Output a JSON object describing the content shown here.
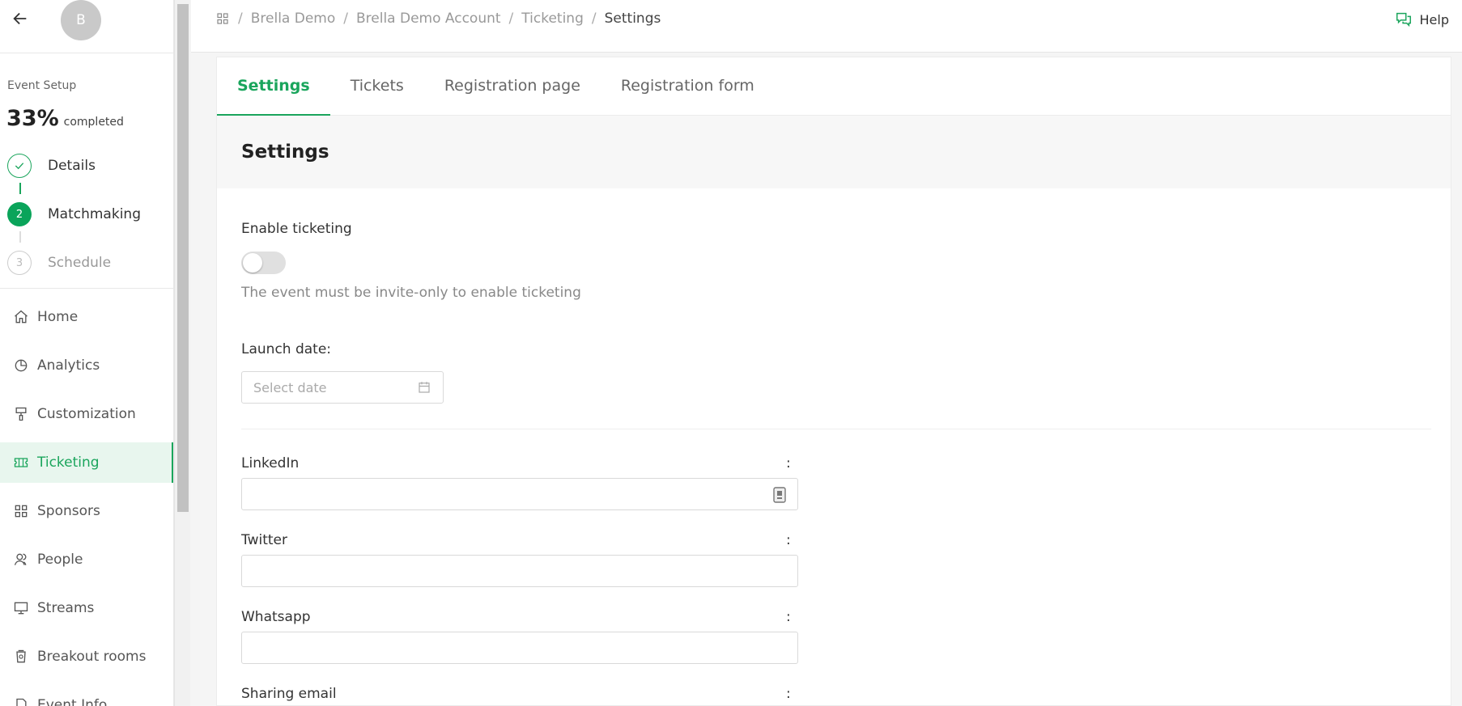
{
  "sidebar": {
    "avatar_initial": "B",
    "setup_label": "Event Setup",
    "progress_value": "33%",
    "progress_word": "completed",
    "steps": [
      {
        "marker": "",
        "label": "Details",
        "state": "done"
      },
      {
        "marker": "2",
        "label": "Matchmaking",
        "state": "active"
      },
      {
        "marker": "3",
        "label": "Schedule",
        "state": "todo"
      }
    ],
    "menu": [
      {
        "label": "Home",
        "icon": "home-icon"
      },
      {
        "label": "Analytics",
        "icon": "pie-chart-icon"
      },
      {
        "label": "Customization",
        "icon": "paint-roller-icon"
      },
      {
        "label": "Ticketing",
        "icon": "ticket-icon",
        "active": true
      },
      {
        "label": "Sponsors",
        "icon": "grid-icon"
      },
      {
        "label": "People",
        "icon": "people-icon"
      },
      {
        "label": "Streams",
        "icon": "monitor-icon"
      },
      {
        "label": "Breakout rooms",
        "icon": "cup-icon"
      },
      {
        "label": "Event Info",
        "icon": "document-icon"
      }
    ]
  },
  "topbar": {
    "breadcrumbs": [
      "Brella Demo",
      "Brella Demo Account",
      "Ticketing",
      "Settings"
    ],
    "help_label": "Help"
  },
  "tabs": [
    "Settings",
    "Tickets",
    "Registration page",
    "Registration form"
  ],
  "section_title": "Settings",
  "form": {
    "enable_label": "Enable ticketing",
    "enable_hint": "The event must be invite-only to enable ticketing",
    "launch_label": "Launch date",
    "launch_colon": ":",
    "date_placeholder": "Select date",
    "fields": [
      {
        "label": "LinkedIn",
        "colon": ":"
      },
      {
        "label": "Twitter",
        "colon": ":"
      },
      {
        "label": "Whatsapp",
        "colon": ":"
      },
      {
        "label": "Sharing email",
        "colon": ":"
      }
    ]
  },
  "colors": {
    "accent": "#1aa55c",
    "active_bg": "#e8f6ee"
  }
}
